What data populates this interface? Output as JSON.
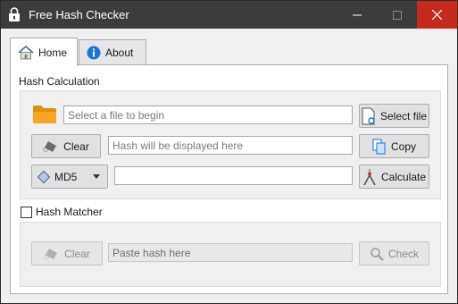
{
  "window": {
    "title": "Free Hash Checker"
  },
  "tabs": [
    {
      "label": "Home",
      "icon": "home-icon"
    },
    {
      "label": "About",
      "icon": "info-icon"
    }
  ],
  "hash_calculation": {
    "label": "Hash Calculation",
    "file_input_placeholder": "Select a file to begin",
    "select_file_label": "Select file",
    "clear_label": "Clear",
    "hash_output_placeholder": "Hash will be displayed here",
    "copy_label": "Copy",
    "algorithm_selected": "MD5",
    "calculate_label": "Calculate"
  },
  "hash_matcher": {
    "label": "Hash Matcher",
    "enabled": false,
    "clear_label": "Clear",
    "paste_placeholder": "Paste hash here",
    "check_label": "Check"
  },
  "colors": {
    "titlebar": "#3c3c3c",
    "close_button": "#c42b1c",
    "folder": "#f6a623",
    "info": "#1a73d8"
  }
}
